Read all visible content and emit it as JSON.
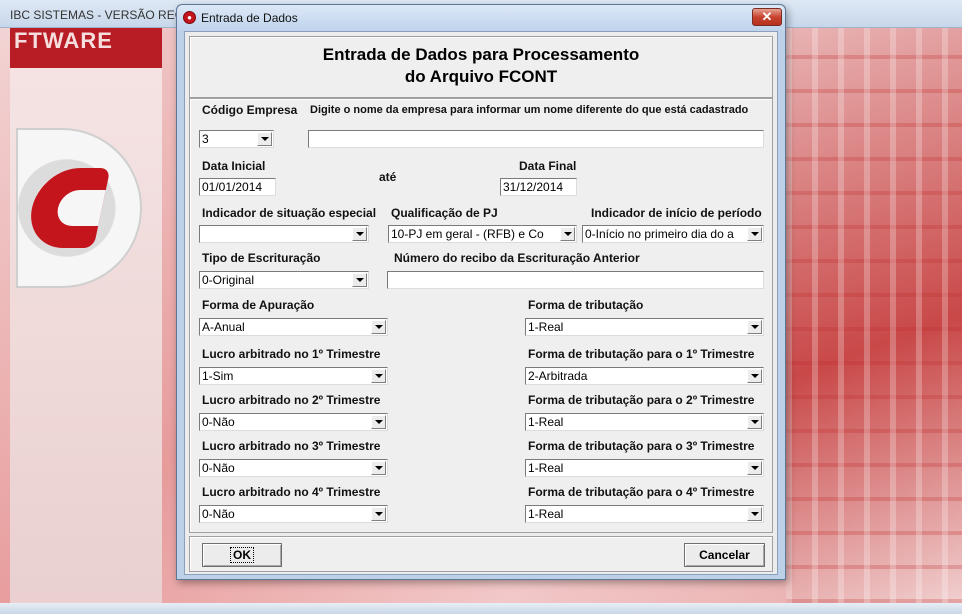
{
  "background_app": {
    "title": "IBC SISTEMAS - VERSÃO REGIST",
    "side_banner_text": "FTWARE"
  },
  "dialog": {
    "title": "Entrada de Dados",
    "close_label": "✕",
    "header_line1": "Entrada de Dados para Processamento",
    "header_line2": "do Arquivo FCONT"
  },
  "form": {
    "codigo_empresa": {
      "label": "Código Empresa",
      "value": "3"
    },
    "nome_empresa": {
      "label": "Digite o nome da empresa para informar um nome diferente do que está cadastrado",
      "value": ""
    },
    "data_inicial": {
      "label": "Data Inicial",
      "value": "01/01/2014"
    },
    "ate_label": "até",
    "data_final": {
      "label": "Data Final",
      "value": "31/12/2014"
    },
    "indicador_situacao": {
      "label": "Indicador de situação especial",
      "value": ""
    },
    "qualificacao_pj": {
      "label": "Qualificação de PJ",
      "value": "10-PJ em geral - (RFB) e Co"
    },
    "indicador_inicio": {
      "label": "Indicador de início de período",
      "value": "0-Início no primeiro dia do a"
    },
    "tipo_escrituracao": {
      "label": "Tipo de Escrituração",
      "value": "0-Original"
    },
    "numero_recibo": {
      "label": "Número do recibo da Escrituração Anterior",
      "value": ""
    },
    "forma_apuracao": {
      "label": "Forma de Apuração",
      "value": "A-Anual"
    },
    "forma_tributacao": {
      "label": "Forma de tributação",
      "value": "1-Real"
    },
    "lucro_1": {
      "label": "Lucro arbitrado no 1º Trimestre",
      "value": "1-Sim"
    },
    "trib_1": {
      "label": "Forma de tributação para o 1º Trimestre",
      "value": "2-Arbitrada"
    },
    "lucro_2": {
      "label": "Lucro arbitrado no 2º Trimestre",
      "value": "0-Não"
    },
    "trib_2": {
      "label": "Forma de tributação para o 2º Trimestre",
      "value": "1-Real"
    },
    "lucro_3": {
      "label": "Lucro arbitrado no 3º Trimestre",
      "value": "0-Não"
    },
    "trib_3": {
      "label": "Forma de tributação para o 3º Trimestre",
      "value": "1-Real"
    },
    "lucro_4": {
      "label": "Lucro arbitrado no 4º Trimestre",
      "value": "0-Não"
    },
    "trib_4": {
      "label": "Forma de tributação para o 4º Trimestre",
      "value": "1-Real"
    }
  },
  "buttons": {
    "ok_label": "OK",
    "cancel_label": "Cancelar"
  }
}
